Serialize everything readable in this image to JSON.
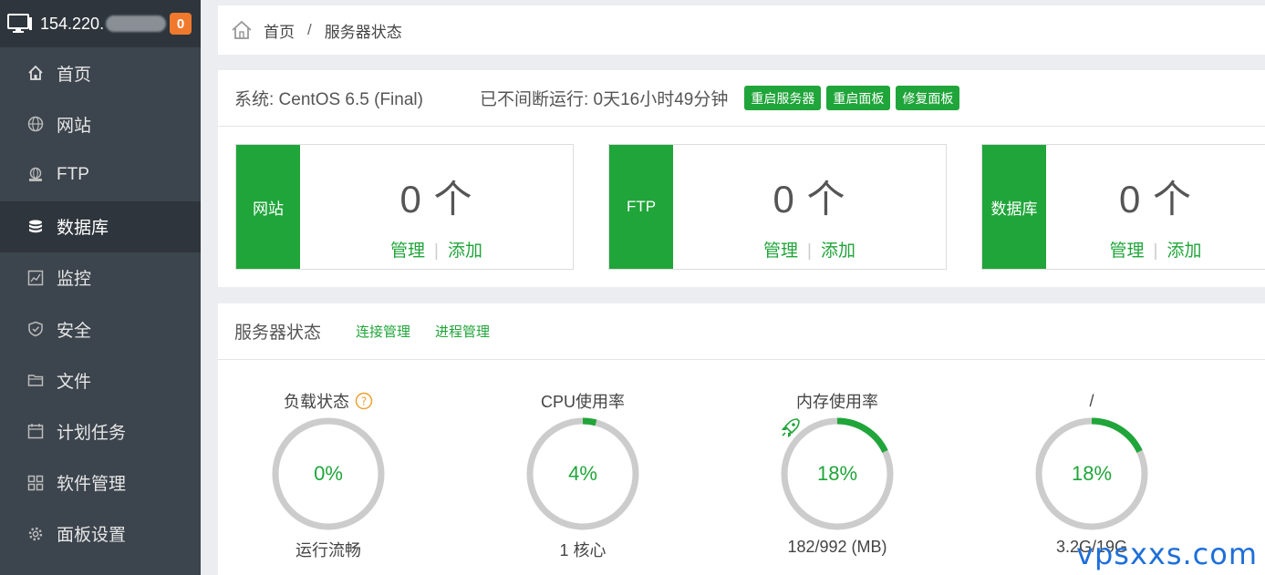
{
  "server": {
    "ip": "154.220.",
    "notifications": "0"
  },
  "sidebar": {
    "items": [
      {
        "label": "首页",
        "icon": "home-icon"
      },
      {
        "label": "网站",
        "icon": "globe-icon"
      },
      {
        "label": "FTP",
        "icon": "ftp-icon"
      },
      {
        "label": "数据库",
        "icon": "database-icon"
      },
      {
        "label": "监控",
        "icon": "monitor-chart-icon"
      },
      {
        "label": "安全",
        "icon": "shield-icon"
      },
      {
        "label": "文件",
        "icon": "folder-icon"
      },
      {
        "label": "计划任务",
        "icon": "calendar-icon"
      },
      {
        "label": "软件管理",
        "icon": "grid-icon"
      },
      {
        "label": "面板设置",
        "icon": "gear-icon"
      }
    ],
    "active_index": 3
  },
  "breadcrumb": {
    "home": "首页",
    "separator": "/",
    "current": "服务器状态"
  },
  "overview": {
    "system": "系统: CentOS 6.5 (Final)",
    "uptime": "已不间断运行: 0天16小时49分钟",
    "buttons": {
      "restart_server": "重启服务器",
      "restart_panel": "重启面板",
      "repair_panel": "修复面板"
    },
    "cards": [
      {
        "label": "网站",
        "count": "0 个",
        "manage": "管理",
        "add": "添加"
      },
      {
        "label": "FTP",
        "count": "0 个",
        "manage": "管理",
        "add": "添加"
      },
      {
        "label": "数据库",
        "count": "0 个",
        "manage": "管理",
        "add": "添加"
      }
    ],
    "link_separator": "|"
  },
  "status": {
    "title": "服务器状态",
    "links": {
      "connections": "连接管理",
      "processes": "进程管理"
    },
    "gauges": [
      {
        "title": "负载状态",
        "percent_text": "0%",
        "value": 0,
        "sub": "运行流畅"
      },
      {
        "title": "CPU使用率",
        "percent_text": "4%",
        "value": 4,
        "sub": "1 核心"
      },
      {
        "title": "内存使用率",
        "percent_text": "18%",
        "value": 18,
        "sub": "182/992 (MB)"
      },
      {
        "title": "/",
        "percent_text": "18%",
        "value": 18,
        "sub": "3.2G/19G"
      }
    ]
  },
  "colors": {
    "accent": "#20a53a",
    "sidebar": "#3c444d",
    "sidebar_active": "#2e353c",
    "badge": "#f0792d",
    "ring_track": "#cccccc"
  },
  "watermark": "vpsxxs.com"
}
